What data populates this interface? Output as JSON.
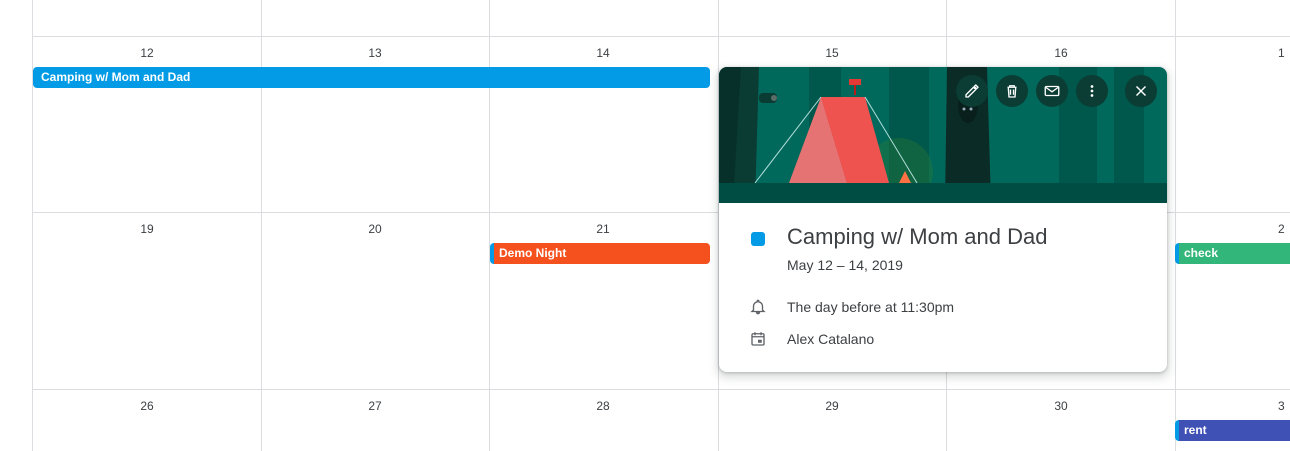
{
  "calendar": {
    "week1_days": [
      "12",
      "13",
      "14",
      "15",
      "16",
      "1"
    ],
    "week2_days": [
      "19",
      "20",
      "21",
      "2"
    ],
    "week3_days": [
      "26",
      "27",
      "28",
      "29",
      "30",
      "3"
    ]
  },
  "events": {
    "camping": "Camping w/ Mom and Dad",
    "demo_night": "Demo Night",
    "check": "check",
    "rent": "rent"
  },
  "colors": {
    "camping": "#039be5",
    "demo_night": "#f4511e",
    "check": "#33b679",
    "rent": "#3f51b5",
    "hero_bg": "#00695c"
  },
  "popover": {
    "title": "Camping w/ Mom and Dad",
    "date": "May 12 – 14, 2019",
    "reminder": "The day before at 11:30pm",
    "calendar_owner": "Alex Catalano",
    "toolbar_icons": [
      "edit-icon",
      "delete-icon",
      "email-icon",
      "more-icon",
      "close-icon"
    ]
  }
}
